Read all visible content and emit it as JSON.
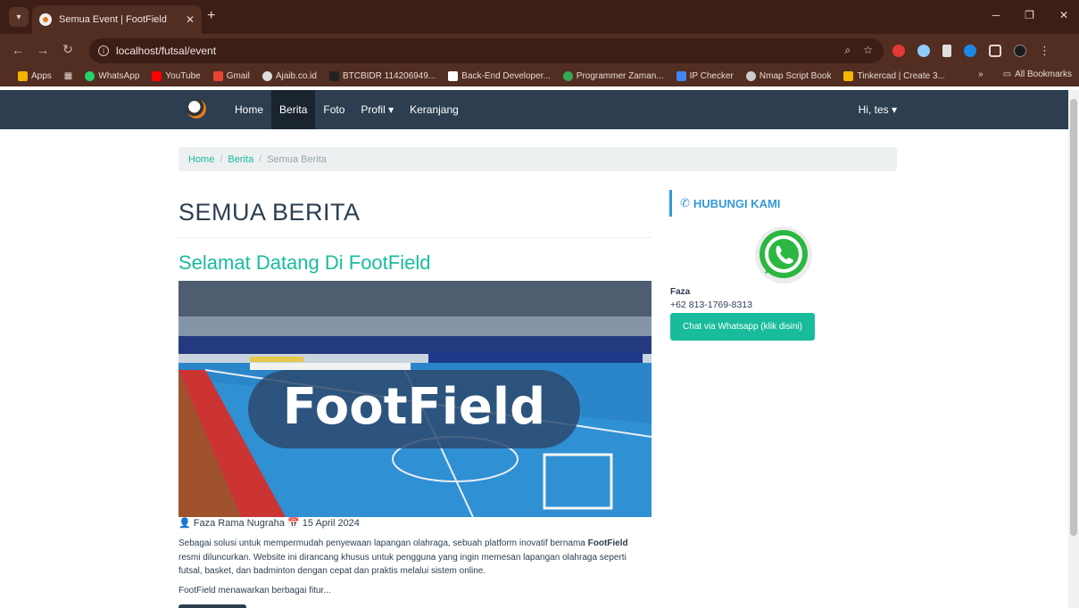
{
  "browser": {
    "tab_title": "Semua Event | FootField",
    "url": "localhost/futsal/event",
    "bookmarks": [
      {
        "label": "Apps",
        "color": "#f4b400"
      },
      {
        "label": "WhatsApp",
        "color": "#25d366"
      },
      {
        "label": "YouTube",
        "color": "#ff0000"
      },
      {
        "label": "Gmail",
        "color": "#ea4335"
      },
      {
        "label": "Ajaib.co.id",
        "color": "#dddddd"
      },
      {
        "label": "BTCBIDR 114206949...",
        "color": "#222222"
      },
      {
        "label": "Back-End Developer...",
        "color": "#ffffff"
      },
      {
        "label": "Programmer Zaman...",
        "color": "#34a853"
      },
      {
        "label": "IP Checker",
        "color": "#4285f4"
      },
      {
        "label": "Nmap Script Book",
        "color": "#cccccc"
      },
      {
        "label": "Tinkercad | Create 3...",
        "color": "#f4b400"
      }
    ],
    "all_bookmarks": "All Bookmarks"
  },
  "navbar": {
    "items": [
      "Home",
      "Berita",
      "Foto",
      "Profil ▾",
      "Keranjang"
    ],
    "active_index": 1,
    "user": "Hi, tes ▾"
  },
  "breadcrumb": {
    "home": "Home",
    "berita": "Berita",
    "current": "Semua Berita"
  },
  "main": {
    "page_title": "SEMUA BERITA",
    "article": {
      "title": "Selamat Datang Di FootField",
      "hero_text": "FootField",
      "author": "Faza Rama Nugraha",
      "date": "15 April 2024",
      "para_prefix": "Sebagai solusi untuk mempermudah penyewaan lapangan olahraga, sebuah platform inovatif bernama ",
      "para_bold": "FootField",
      "para_suffix": " resmi diluncurkan. Website ini dirancang khusus untuk pengguna yang ingin memesan lapangan olahraga seperti futsal, basket, dan badminton dengan cepat dan praktis melalui sistem online.",
      "para2": "FootField menawarkan berbagai fitur..."
    }
  },
  "sidebar": {
    "heading": "HUBUNGI KAMI",
    "contact_name": "Faza",
    "contact_phone": "+62 813-1769-8313",
    "button": "Chat via Whatsapp (klik disini)"
  },
  "colors": {
    "navbar": "#2c3e50",
    "accent": "#18bc9c",
    "side_accent": "#3498db"
  }
}
